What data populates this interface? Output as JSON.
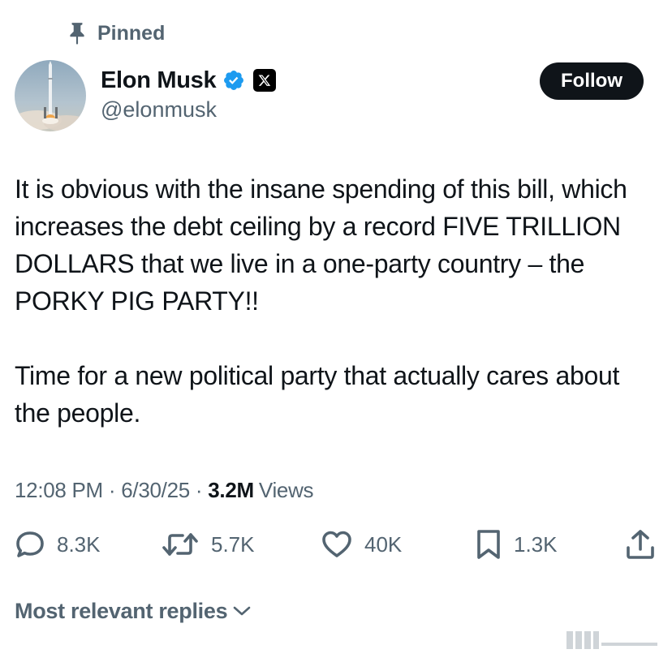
{
  "pinned": {
    "label": "Pinned",
    "icon": "pin-icon"
  },
  "author": {
    "display_name": "Elon Musk",
    "handle": "@elonmusk",
    "verified_color": "#1d9bf0",
    "affiliation_badge": "x-logo-icon"
  },
  "follow_button": {
    "label": "Follow"
  },
  "tweet": {
    "paragraphs": [
      "It is obvious with the insane spending of this bill, which increases the debt ceiling by a record FIVE TRILLION DOLLARS that we live in a one-party country – the PORKY PIG PARTY!!",
      "Time for a new political party that actually cares about the people."
    ]
  },
  "meta": {
    "time": "12:08 PM",
    "separator": "·",
    "date": "6/30/25",
    "views_count": "3.2M",
    "views_label": "Views"
  },
  "actions": {
    "replies": "8.3K",
    "reposts": "5.7K",
    "likes": "40K",
    "bookmarks": "1.3K",
    "share_icon": "share-icon"
  },
  "replies_sort": {
    "label": "Most relevant replies",
    "icon": "chevron-down-icon"
  },
  "colors": {
    "text": "#0f1419",
    "secondary": "#536471",
    "accent": "#1d9bf0"
  }
}
